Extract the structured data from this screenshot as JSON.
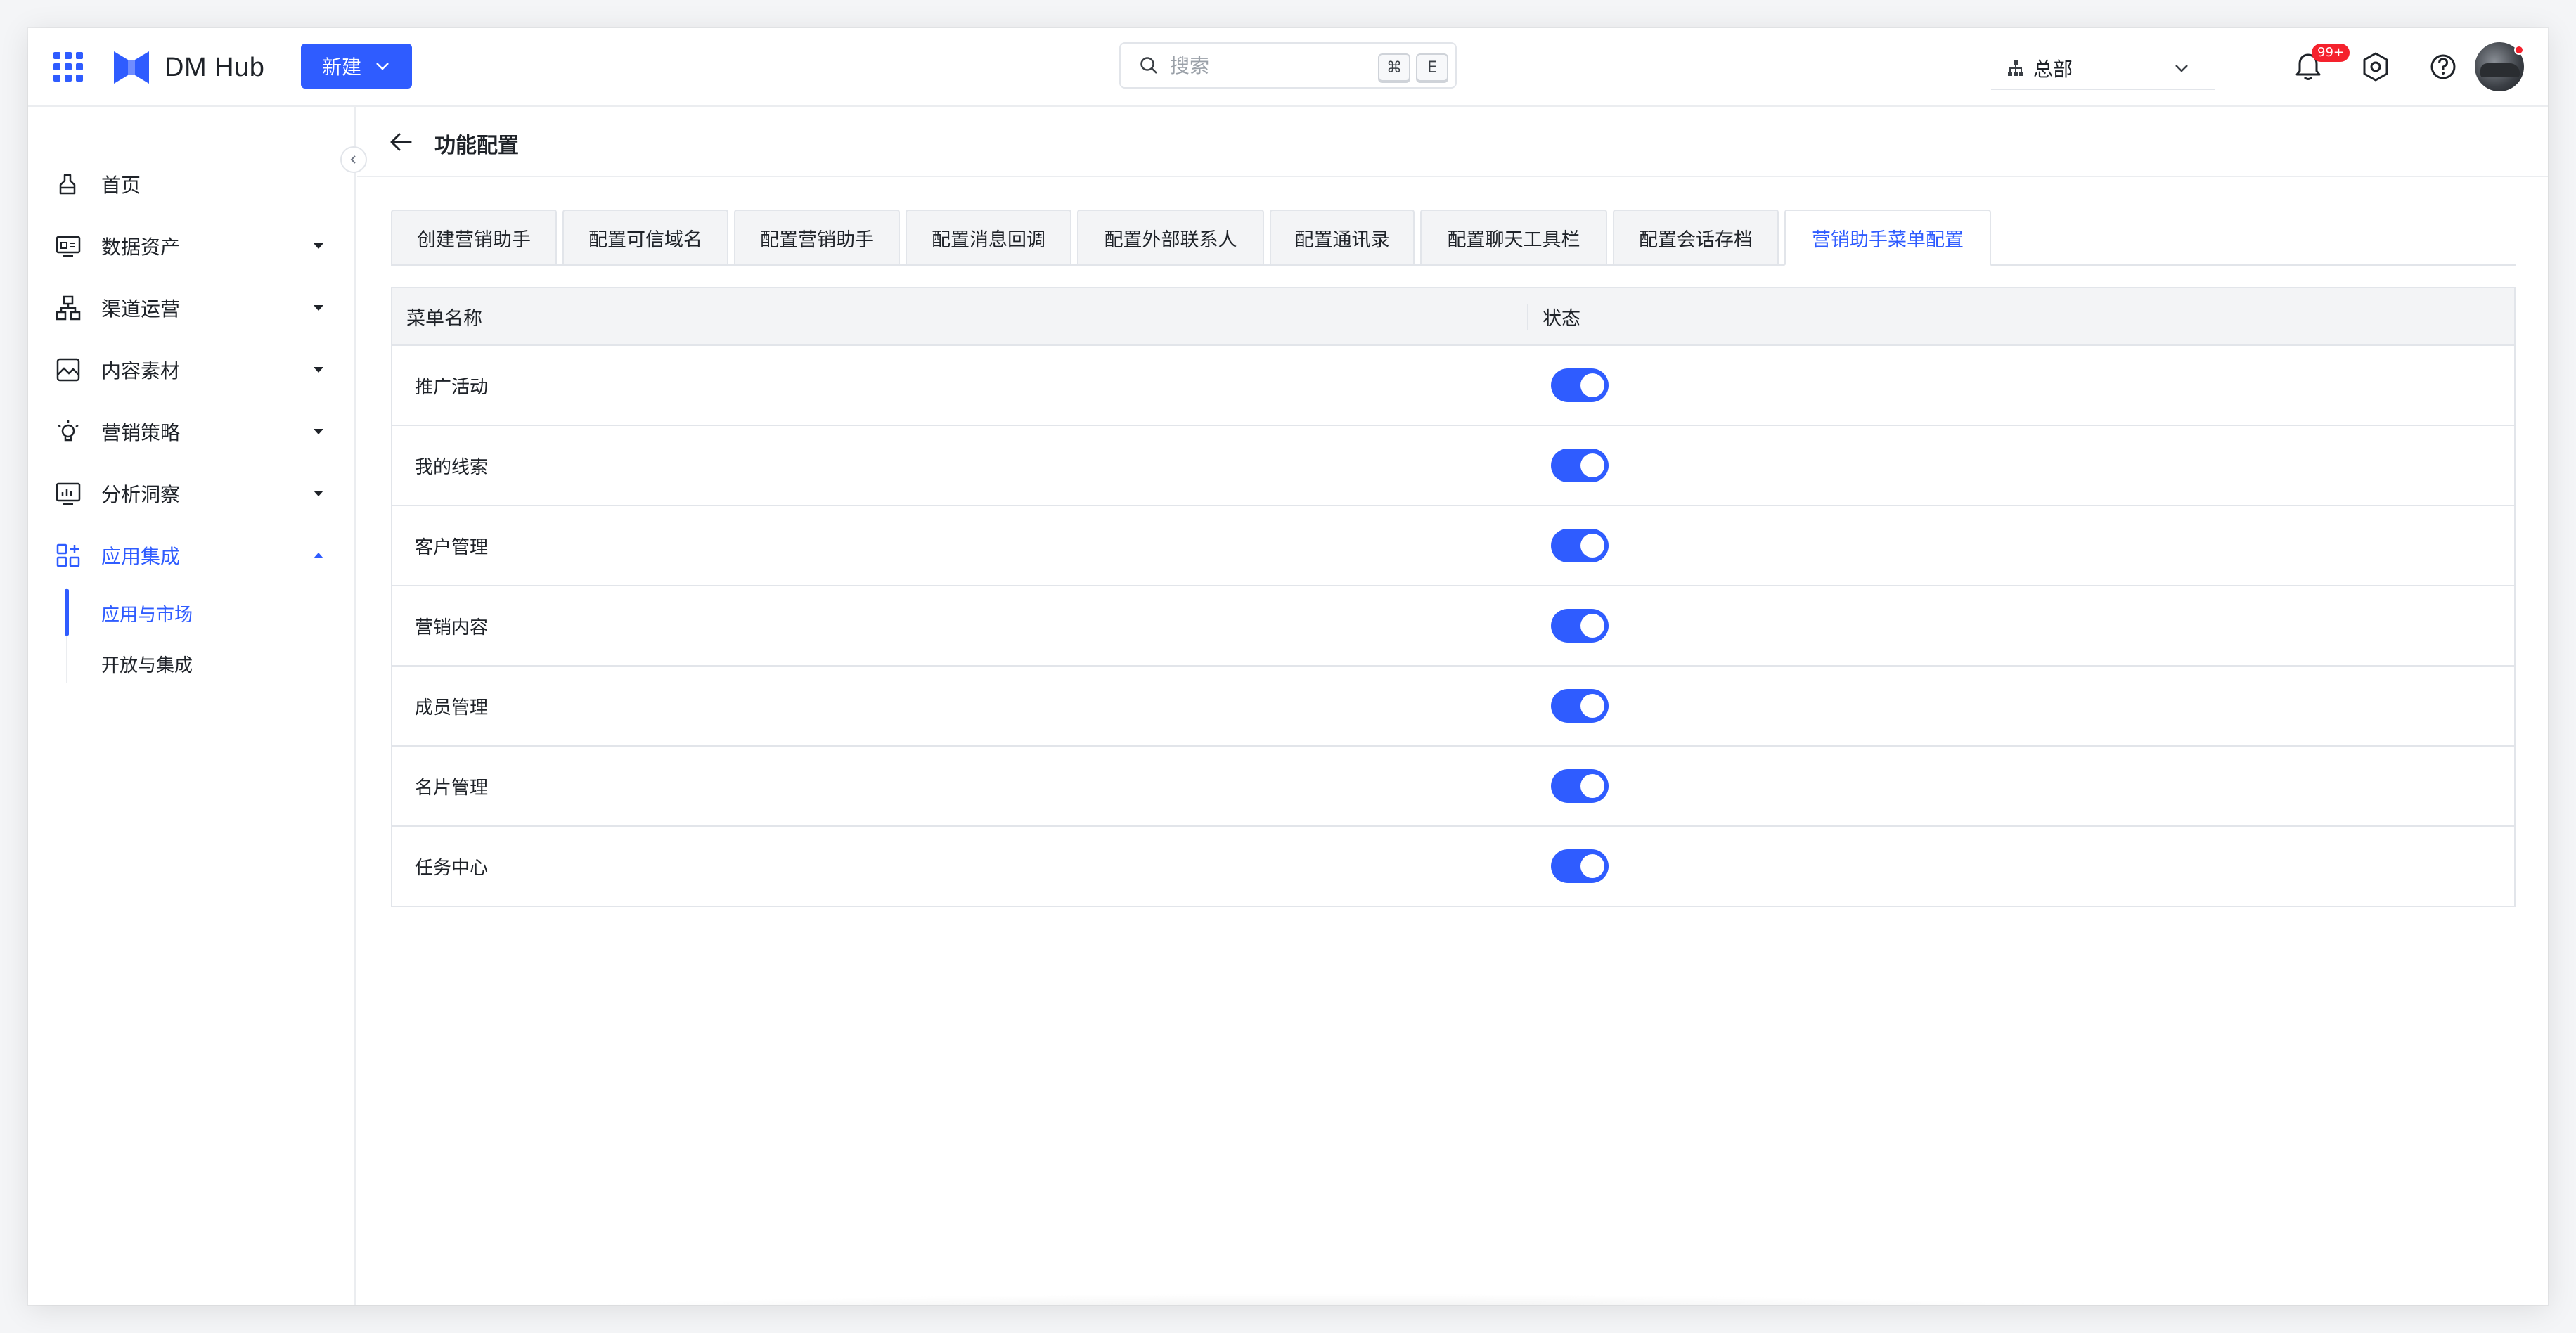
{
  "header": {
    "logo_text": "DM Hub",
    "new_button_label": "新建",
    "search_placeholder": "搜索",
    "search_shortcut_cmd": "⌘",
    "search_shortcut_key": "E",
    "org_label": "总部",
    "notification_badge": "99+",
    "icons": [
      "apps-grid-icon",
      "bell-icon",
      "settings-icon",
      "help-icon"
    ]
  },
  "sidebar": {
    "items": [
      {
        "label": "首页",
        "icon": "home-icon"
      },
      {
        "label": "数据资产",
        "icon": "data-assets-icon"
      },
      {
        "label": "渠道运营",
        "icon": "channel-icon"
      },
      {
        "label": "内容素材",
        "icon": "content-icon"
      },
      {
        "label": "营销策略",
        "icon": "strategy-icon"
      },
      {
        "label": "分析洞察",
        "icon": "analytics-icon"
      },
      {
        "label": "应用集成",
        "icon": "apps-integration-icon"
      }
    ],
    "sub_items": [
      {
        "label": "应用与市场",
        "active": true
      },
      {
        "label": "开放与集成",
        "active": false
      }
    ]
  },
  "page": {
    "title": "功能配置",
    "tabs": [
      "创建营销助手",
      "配置可信域名",
      "配置营销助手",
      "配置消息回调",
      "配置外部联系人",
      "配置通讯录",
      "配置聊天工具栏",
      "配置会话存档",
      "营销助手菜单配置"
    ],
    "active_tab": "营销助手菜单配置",
    "table": {
      "columns": [
        "菜单名称",
        "状态"
      ],
      "rows": [
        {
          "name": "推广活动",
          "enabled": true
        },
        {
          "name": "我的线索",
          "enabled": true
        },
        {
          "name": "客户管理",
          "enabled": true
        },
        {
          "name": "营销内容",
          "enabled": true
        },
        {
          "name": "成员管理",
          "enabled": true
        },
        {
          "name": "名片管理",
          "enabled": true
        },
        {
          "name": "任务中心",
          "enabled": true
        }
      ]
    }
  },
  "colors": {
    "accent": "#2f5cff",
    "badge": "#f5222d"
  }
}
